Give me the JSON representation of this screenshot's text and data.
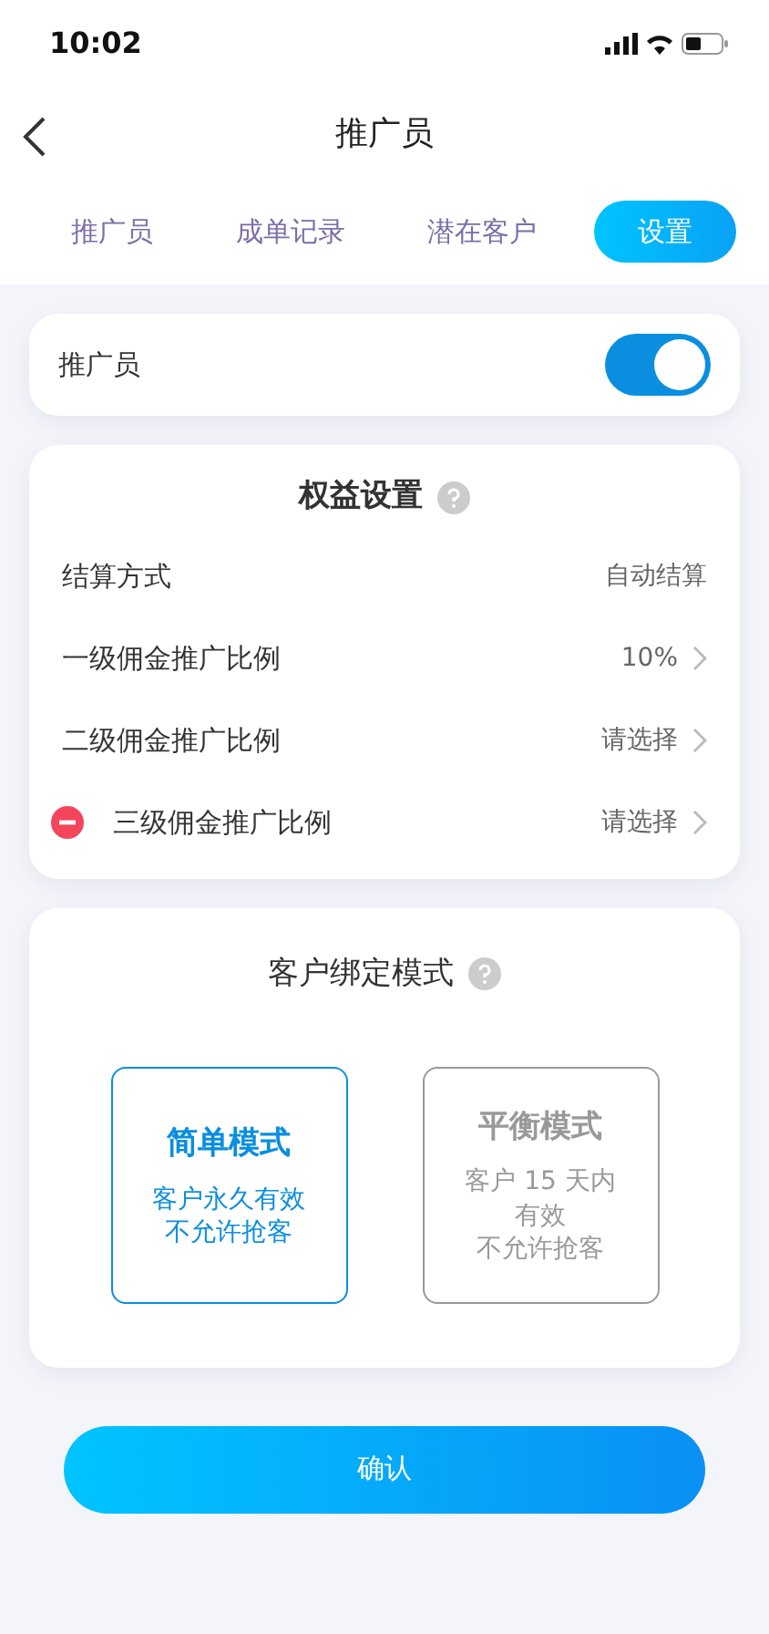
{
  "status_bar": {
    "time": "10:02"
  },
  "header": {
    "title": "推广员"
  },
  "tabs": [
    {
      "label": "推广员",
      "selected": false
    },
    {
      "label": "成单记录",
      "selected": false
    },
    {
      "label": "潜在客户",
      "selected": false
    },
    {
      "label": "设置",
      "selected": true
    }
  ],
  "toggle_row": {
    "label": "推广员",
    "on": true
  },
  "benefits": {
    "title": "权益设置",
    "rows": [
      {
        "label": "结算方式",
        "value": "自动结算",
        "kind": "text",
        "removable": false
      },
      {
        "label": "一级佣金推广比例",
        "value": "10%",
        "kind": "select",
        "removable": false
      },
      {
        "label": "二级佣金推广比例",
        "value": "请选择",
        "kind": "select",
        "removable": false
      },
      {
        "label": "三级佣金推广比例",
        "value": "请选择",
        "kind": "select",
        "removable": true
      }
    ]
  },
  "binding": {
    "title": "客户绑定模式",
    "modes": [
      {
        "name": "简单模式",
        "description": [
          "客户永久有效",
          "不允许抢客"
        ],
        "selected": true
      },
      {
        "name": "平衡模式",
        "description": [
          "客户 15 天内",
          "有效",
          "不允许抢客"
        ],
        "selected": false
      }
    ]
  },
  "confirm_button": "确认"
}
